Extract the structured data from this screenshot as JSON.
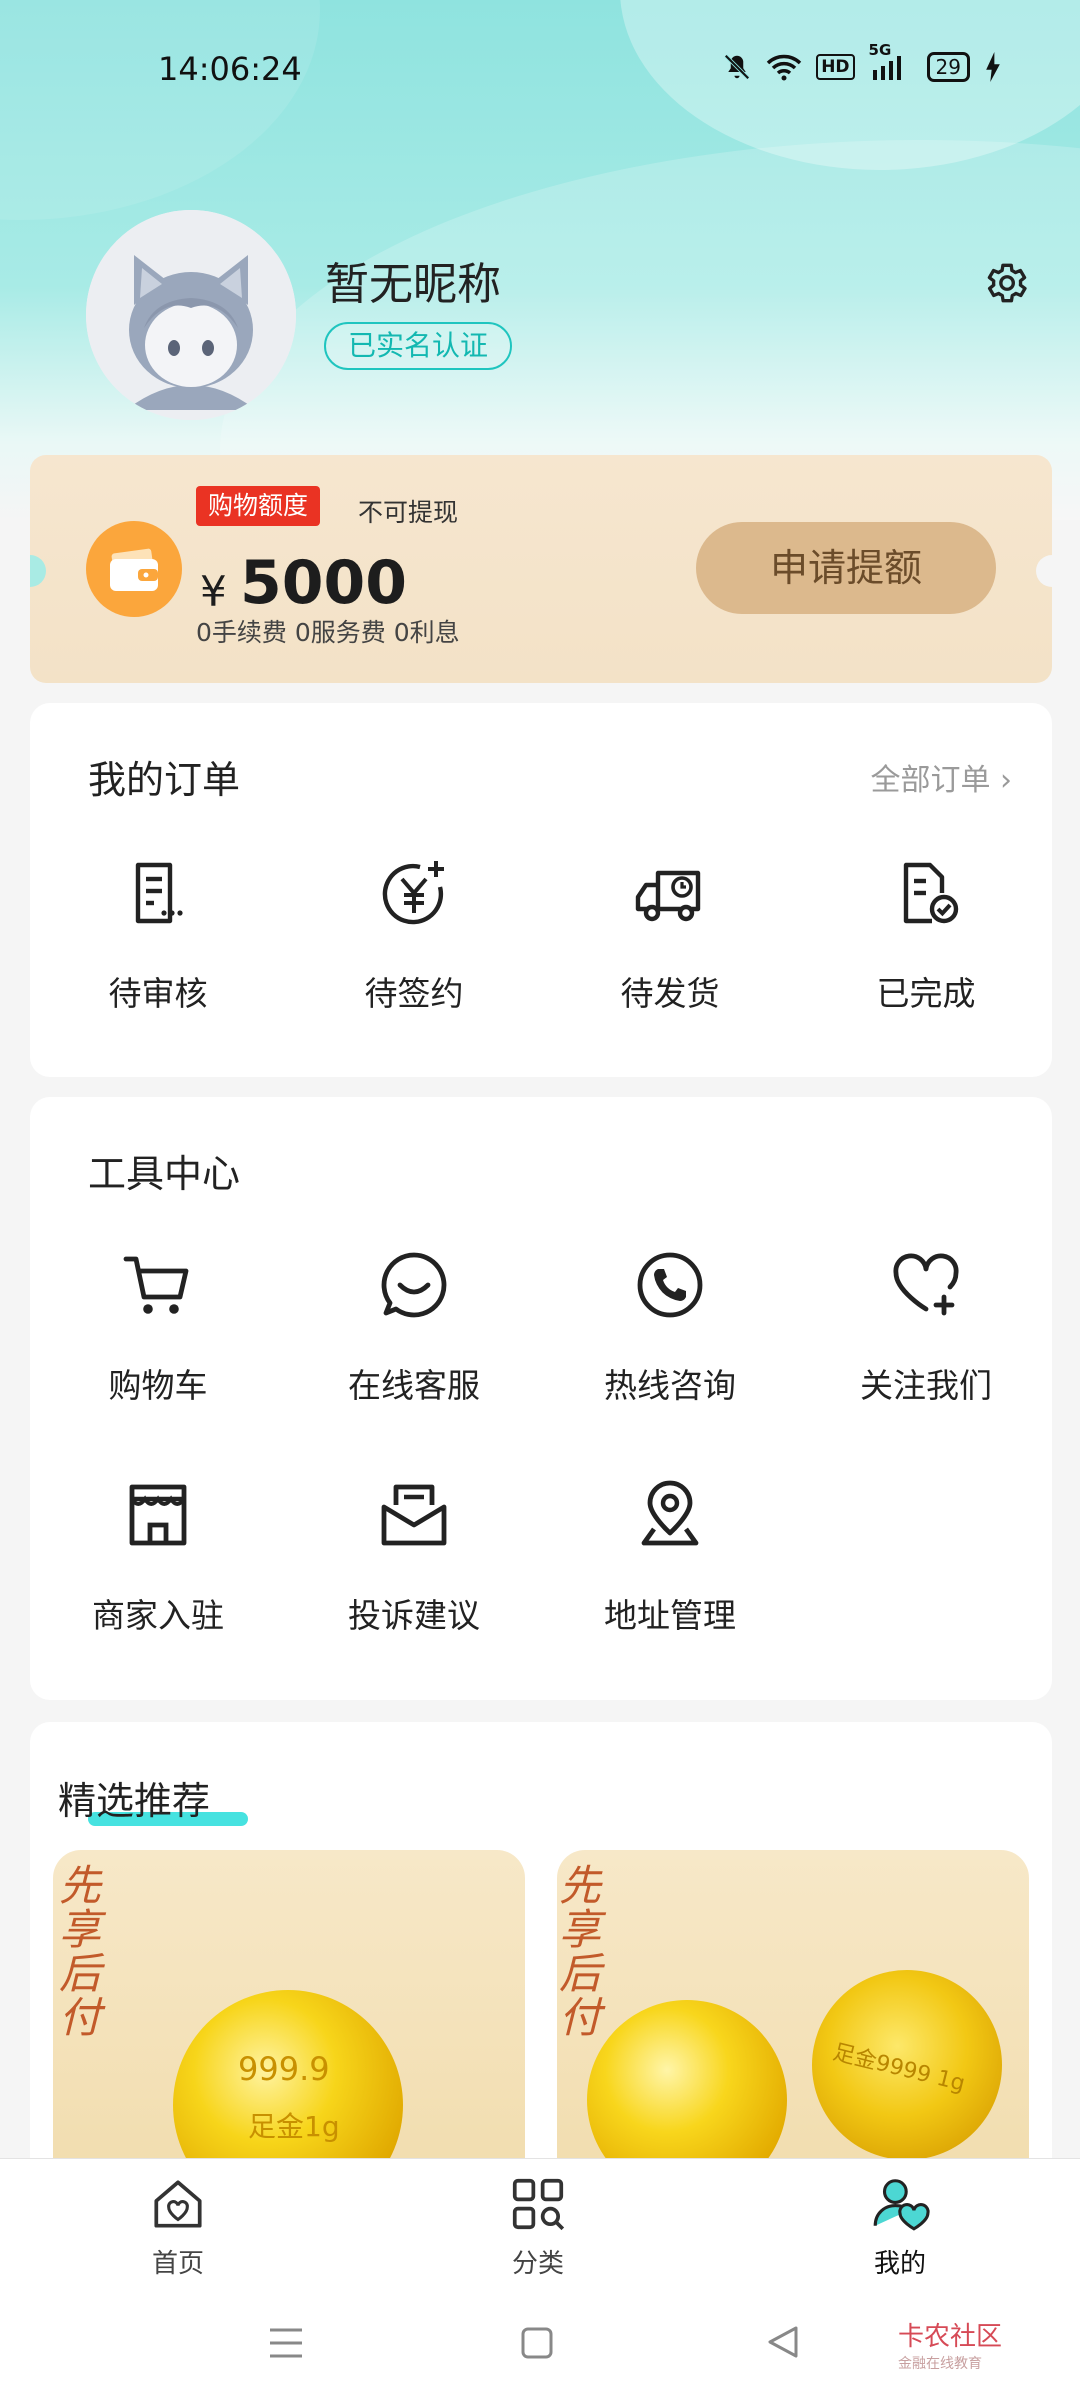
{
  "status_bar": {
    "time": "14:06:24",
    "battery": "29",
    "network": "5G",
    "hd": "HD"
  },
  "profile": {
    "nickname": "暂无昵称",
    "verify_badge": "已实名认证"
  },
  "credit_card": {
    "tag": "购物额度",
    "note": "不可提现",
    "currency": "¥",
    "amount": "5000",
    "fees": "0手续费 0服务费 0利息",
    "apply_button": "申请提额"
  },
  "orders": {
    "title": "我的订单",
    "all_link": "全部订单",
    "items": [
      {
        "label": "待审核",
        "icon": "pending-review-icon"
      },
      {
        "label": "待签约",
        "icon": "pending-sign-icon"
      },
      {
        "label": "待发货",
        "icon": "pending-ship-icon"
      },
      {
        "label": "已完成",
        "icon": "completed-icon"
      }
    ]
  },
  "tools": {
    "title": "工具中心",
    "items": [
      {
        "label": "购物车",
        "icon": "cart-icon"
      },
      {
        "label": "在线客服",
        "icon": "chat-icon"
      },
      {
        "label": "热线咨询",
        "icon": "phone-icon"
      },
      {
        "label": "关注我们",
        "icon": "heart-plus-icon"
      },
      {
        "label": "商家入驻",
        "icon": "store-icon"
      },
      {
        "label": "投诉建议",
        "icon": "mail-icon"
      },
      {
        "label": "地址管理",
        "icon": "location-icon"
      }
    ]
  },
  "recommend": {
    "title": "精选推荐",
    "product1": {
      "stamp": "先享后付",
      "coin_text1": "999.9",
      "coin_text2": "足金1g"
    },
    "product2": {
      "stamp": "先享后付",
      "coin_text": "足金9999 1g"
    }
  },
  "tabbar": {
    "items": [
      {
        "label": "首页",
        "icon": "home-icon"
      },
      {
        "label": "分类",
        "icon": "category-icon"
      },
      {
        "label": "我的",
        "icon": "profile-icon"
      }
    ],
    "active": "我的"
  },
  "watermark": {
    "name": "卡农社区",
    "sub": "金融在线教育"
  },
  "colors": {
    "accent": "#1fc5bf",
    "gold_button": "#dcb98d",
    "red_tag": "#ea3323",
    "wallet_orange": "#fba63c"
  }
}
